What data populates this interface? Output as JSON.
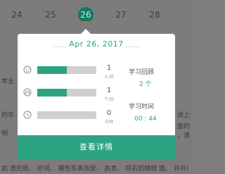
{
  "calendar": {
    "days": [
      "24",
      "25",
      "26",
      "27",
      "28"
    ],
    "selected_day": "26"
  },
  "popup": {
    "date": "Apr 26, 2017",
    "rows": [
      {
        "icon": "smile-icon",
        "value": "1",
        "unit": "人/份",
        "progress": 0.5
      },
      {
        "icon": "headset-icon",
        "value": "1",
        "unit": "个/份",
        "progress": 0.5
      },
      {
        "icon": "clock-icon",
        "value": "0",
        "unit": "分钟",
        "progress": 0.0
      }
    ],
    "review": {
      "label": "学习回顾",
      "value": "2 个"
    },
    "time": {
      "label": "学习时间",
      "value": "00 : 44"
    },
    "details_button": "查看详情"
  },
  "background_text": {
    "left_1": "本业",
    "left_2": "的年",
    "left_3": "明",
    "bottom": "如 透先题、 好词、 哪些东表改受、 执意、 符石的精题 饿。 并开训的",
    "right_1": "说上阅读",
    "right_2": "面的学生",
    "right_3": "，请上说"
  },
  "colors": {
    "accent": "#2ea382",
    "accent_dark": "#117a63",
    "overlay": "#7c7c7c"
  }
}
